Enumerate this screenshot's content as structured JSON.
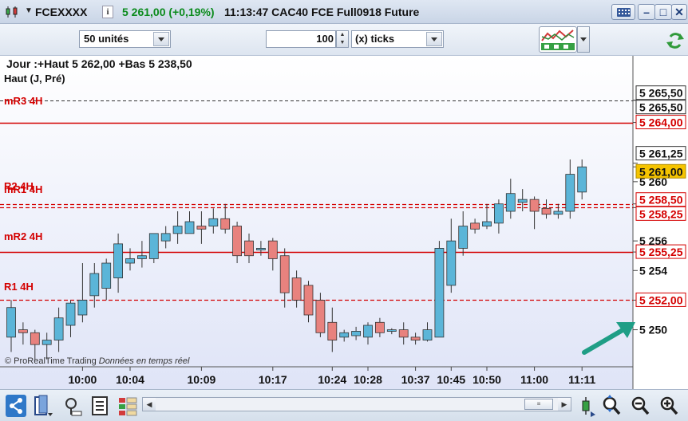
{
  "title_bar": {
    "symbol": "FCEXXXX",
    "info_glyph": "i",
    "price_change": "5 261,00 (+0,19%)",
    "description": "11:13:47 CAC40 FCE Full0918 Future"
  },
  "toolbar": {
    "units_value": "50 unités",
    "count_value": "100",
    "ticks_value": "(x) ticks"
  },
  "chart_header": {
    "line1": "Jour :+Haut 5 262,00 +Bas 5 238,50",
    "line2": "Haut (J, Pré)"
  },
  "watermark": {
    "brand": "© ProRealTime Trading",
    "note": "Données en temps réel"
  },
  "levels": {
    "mR3": "mR3 4H",
    "R2": "R2 4H",
    "mR1": "mR1 4H",
    "mR2": "mR2 4H",
    "R1": "R1 4H"
  },
  "colors": {
    "bull": "#5bb5d8",
    "bear": "#e8827e",
    "level_line": "#d40000",
    "price_tag": "#f5c400"
  },
  "chart_data": {
    "type": "candlestick",
    "y_range": [
      5247.5,
      5268.5
    ],
    "y_ticks": [
      {
        "value": 5250,
        "label": "5 250"
      },
      {
        "value": 5252,
        "label": "5 252,00",
        "kind": "level"
      },
      {
        "value": 5254,
        "label": "5 254"
      },
      {
        "value": 5255.25,
        "label": "5 255,25",
        "kind": "level"
      },
      {
        "value": 5256,
        "label": "5 256"
      },
      {
        "value": 5258.25,
        "label": "5 258,25",
        "kind": "level"
      },
      {
        "value": 5258.5,
        "label": "5 258,50",
        "kind": "level"
      },
      {
        "value": 5260,
        "label": "5 260"
      },
      {
        "value": 5261,
        "label": "5 261,00",
        "kind": "price"
      },
      {
        "value": 5261.25,
        "label": "5 261,25",
        "kind": "boxed"
      },
      {
        "value": 5264,
        "label": "5 264,00",
        "kind": "level"
      },
      {
        "value": 5265.5,
        "label": "5 265,50",
        "kind": "boxed"
      },
      {
        "value": 5265.5,
        "label": "5 265,50",
        "kind": "boxed"
      }
    ],
    "x_labels": [
      "10:00",
      "10:04",
      "10:09",
      "10:17",
      "10:24",
      "10:28",
      "10:37",
      "10:45",
      "10:50",
      "11:00",
      "11:11"
    ],
    "horizontal_lines": [
      {
        "name": "Haut (J, Pré)",
        "value": 5265.5,
        "style": "dashed-black"
      },
      {
        "name": "mR3 4H",
        "value": 5264.0,
        "style": "solid-red"
      },
      {
        "name": "R2 4H",
        "value": 5258.5,
        "style": "dashed-red"
      },
      {
        "name": "mR1 4H",
        "value": 5258.25,
        "style": "dashed-red"
      },
      {
        "name": "mR2 4H",
        "value": 5255.25,
        "style": "solid-red"
      },
      {
        "name": "R1 4H",
        "value": 5252.0,
        "style": "dashed-red"
      }
    ],
    "candles": [
      {
        "o": 5249.5,
        "h": 5252.0,
        "l": 5248.5,
        "c": 5251.5
      },
      {
        "o": 5250.0,
        "h": 5250.5,
        "l": 5249.0,
        "c": 5249.8
      },
      {
        "o": 5249.8,
        "h": 5250.0,
        "l": 5248.0,
        "c": 5249.0
      },
      {
        "o": 5249.0,
        "h": 5249.8,
        "l": 5248.0,
        "c": 5249.3
      },
      {
        "o": 5249.3,
        "h": 5251.5,
        "l": 5248.5,
        "c": 5250.8
      },
      {
        "o": 5250.3,
        "h": 5252.0,
        "l": 5249.5,
        "c": 5251.8
      },
      {
        "o": 5251.0,
        "h": 5254.5,
        "l": 5250.5,
        "c": 5252.0
      },
      {
        "o": 5252.3,
        "h": 5254.5,
        "l": 5251.5,
        "c": 5253.8
      },
      {
        "o": 5252.8,
        "h": 5254.8,
        "l": 5252.0,
        "c": 5254.5
      },
      {
        "o": 5253.5,
        "h": 5256.5,
        "l": 5252.5,
        "c": 5255.8
      },
      {
        "o": 5254.5,
        "h": 5255.5,
        "l": 5254.0,
        "c": 5254.8
      },
      {
        "o": 5254.8,
        "h": 5256.0,
        "l": 5254.2,
        "c": 5255.0
      },
      {
        "o": 5254.8,
        "h": 5256.5,
        "l": 5254.5,
        "c": 5256.5
      },
      {
        "o": 5256.0,
        "h": 5257.0,
        "l": 5255.5,
        "c": 5256.5
      },
      {
        "o": 5256.5,
        "h": 5258.0,
        "l": 5255.8,
        "c": 5257.0
      },
      {
        "o": 5256.5,
        "h": 5258.0,
        "l": 5256.5,
        "c": 5257.3
      },
      {
        "o": 5257.0,
        "h": 5258.0,
        "l": 5255.8,
        "c": 5256.8
      },
      {
        "o": 5257.0,
        "h": 5258.2,
        "l": 5256.5,
        "c": 5257.5
      },
      {
        "o": 5257.5,
        "h": 5258.5,
        "l": 5256.5,
        "c": 5256.8
      },
      {
        "o": 5257.0,
        "h": 5257.3,
        "l": 5254.5,
        "c": 5255.0
      },
      {
        "o": 5256.0,
        "h": 5256.5,
        "l": 5254.5,
        "c": 5255.0
      },
      {
        "o": 5255.5,
        "h": 5256.0,
        "l": 5255.0,
        "c": 5255.5
      },
      {
        "o": 5256.0,
        "h": 5256.2,
        "l": 5254.0,
        "c": 5254.8
      },
      {
        "o": 5255.0,
        "h": 5255.5,
        "l": 5251.5,
        "c": 5252.5
      },
      {
        "o": 5253.5,
        "h": 5254.0,
        "l": 5251.5,
        "c": 5252.0
      },
      {
        "o": 5253.0,
        "h": 5253.3,
        "l": 5250.5,
        "c": 5251.0
      },
      {
        "o": 5252.0,
        "h": 5252.5,
        "l": 5249.5,
        "c": 5249.8
      },
      {
        "o": 5250.5,
        "h": 5251.5,
        "l": 5248.5,
        "c": 5249.3
      },
      {
        "o": 5249.5,
        "h": 5250.0,
        "l": 5249.2,
        "c": 5249.8
      },
      {
        "o": 5249.6,
        "h": 5250.2,
        "l": 5249.3,
        "c": 5249.9
      },
      {
        "o": 5249.5,
        "h": 5250.5,
        "l": 5249.0,
        "c": 5250.3
      },
      {
        "o": 5250.5,
        "h": 5250.8,
        "l": 5249.5,
        "c": 5249.8
      },
      {
        "o": 5249.9,
        "h": 5250.1,
        "l": 5249.7,
        "c": 5250.0
      },
      {
        "o": 5250.0,
        "h": 5250.5,
        "l": 5249.0,
        "c": 5249.5
      },
      {
        "o": 5249.5,
        "h": 5249.8,
        "l": 5249.0,
        "c": 5249.3
      },
      {
        "o": 5249.3,
        "h": 5250.5,
        "l": 5249.2,
        "c": 5250.0
      },
      {
        "o": 5249.5,
        "h": 5256.0,
        "l": 5249.5,
        "c": 5255.5
      },
      {
        "o": 5253.0,
        "h": 5257.5,
        "l": 5252.5,
        "c": 5256.0
      },
      {
        "o": 5255.5,
        "h": 5258.0,
        "l": 5255.0,
        "c": 5257.0
      },
      {
        "o": 5257.2,
        "h": 5257.5,
        "l": 5256.5,
        "c": 5256.8
      },
      {
        "o": 5257.0,
        "h": 5258.5,
        "l": 5256.8,
        "c": 5257.3
      },
      {
        "o": 5257.2,
        "h": 5258.8,
        "l": 5256.5,
        "c": 5258.5
      },
      {
        "o": 5258.0,
        "h": 5260.2,
        "l": 5257.5,
        "c": 5259.2
      },
      {
        "o": 5258.6,
        "h": 5259.5,
        "l": 5258.0,
        "c": 5258.8
      },
      {
        "o": 5258.8,
        "h": 5259.0,
        "l": 5256.8,
        "c": 5258.0
      },
      {
        "o": 5258.2,
        "h": 5258.8,
        "l": 5257.5,
        "c": 5257.8
      },
      {
        "o": 5257.8,
        "h": 5258.5,
        "l": 5257.5,
        "c": 5258.0
      },
      {
        "o": 5258.0,
        "h": 5261.5,
        "l": 5257.5,
        "c": 5260.5
      },
      {
        "o": 5259.3,
        "h": 5261.5,
        "l": 5258.8,
        "c": 5261.0
      }
    ]
  }
}
